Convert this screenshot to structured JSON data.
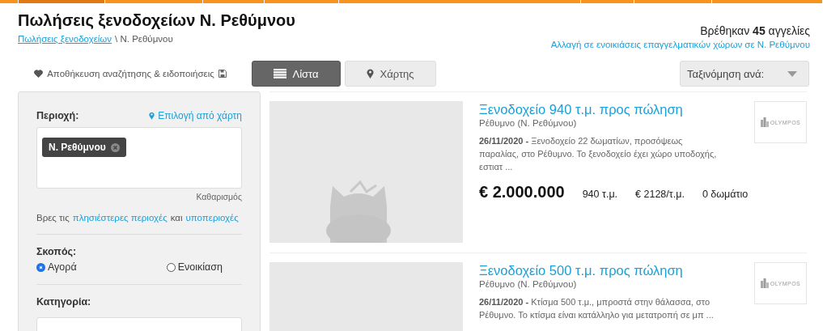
{
  "header": {
    "title": "Πωλήσεις ξενοδοχείων Ν. Ρεθύμνου",
    "breadcrumb": [
      {
        "label": "Πωλήσεις ξενοδοχείων",
        "kind": "link"
      },
      {
        "label": "\\ Ν. Ρεθύμνου",
        "kind": "current"
      }
    ],
    "results": "Βρέθηκαν **45** αγγελίες",
    "switch_link": "Αλλαγή σε ενοικιάσεις επαγγελματικών χώρων σε Ν. Ρεθύμνου"
  },
  "save_search": "Αποθήκευση αναζήτησης & ειδοποιήσεις",
  "view_tabs": [
    {
      "label": "Λίστα",
      "kind": "list",
      "selected": true
    },
    {
      "label": "Χάρτης",
      "kind": "map",
      "selected": false
    }
  ],
  "sort": {
    "label": "Ταξινόμηση ανά:"
  },
  "sidebar": {
    "region_label": "Περιοχή:",
    "map_link": "Επιλογή από χάρτη",
    "chips": [
      "Ν. Ρεθύμνου"
    ],
    "clear": "Καθαρισμός",
    "nearby": "Βρες τις",
    "nearby_link": "πλησιέστερες περιοχές",
    "nearby_and": "και",
    "sub_link": "υποπεριοχές",
    "purpose_label": "Σκοπός:",
    "purposes": [
      {
        "label": "Αγορά",
        "selected": true
      },
      {
        "label": "Ενοικίαση",
        "selected": false
      }
    ],
    "category_label": "Κατηγορία:"
  },
  "listings": [
    {
      "title": "Ξενοδοχείο 940 τ.μ. προς πώληση",
      "location": "Ρέθυμνο (Ν. Ρεθύμνου)",
      "date": "26/11/2020 -",
      "description": "Ξενοδοχείο 22 δωματίων, προσόψεως παραλίας, στο Ρέθυμνο. Το ξενοδοχείο έχει χώρο υποδοχής, εστιατ ...",
      "price": "€ 2.000.000",
      "facts": [
        "940 τ.μ.",
        "€ 2128/τ.μ.",
        "0 δωμάτιο"
      ],
      "agency": "OLYMPOS"
    },
    {
      "title": "Ξενοδοχείο 500 τ.μ. προς πώληση",
      "location": "Ρέθυμνο (Ν. Ρεθύμνου)",
      "date": "26/11/2020 -",
      "description": "Κτίσμα 500 τ.μ., μπροστά στην θάλασσα, στο Ρέθυμνο. Το κτίσμα είναι κατάλληλο για μετατροπή σε μπ ...",
      "agency": "OLYMPOS"
    }
  ]
}
